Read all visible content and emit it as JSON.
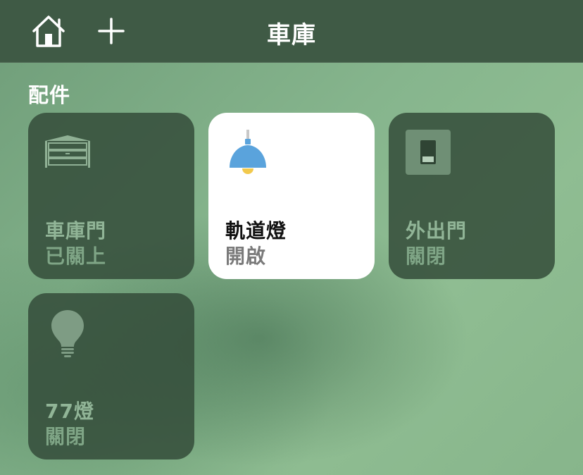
{
  "header": {
    "title": "車庫",
    "home_icon": "home-icon",
    "add_icon": "plus-icon"
  },
  "section": {
    "title": "配件"
  },
  "accessories": [
    {
      "name": "車庫門",
      "status": "已關上",
      "icon": "garage-door-icon",
      "on": false
    },
    {
      "name": "軌道燈",
      "status": "開啟",
      "icon": "pendant-lamp-icon",
      "on": true
    },
    {
      "name": "外出門",
      "status": "關閉",
      "icon": "switch-icon",
      "on": false
    },
    {
      "name": "77燈",
      "status": "關閉",
      "icon": "lightbulb-icon",
      "on": false
    }
  ],
  "colors": {
    "header_bg": "#3f5a45",
    "tile_off_bg": "#344d3a",
    "tile_on_bg": "#ffffff",
    "lamp_shade": "#5aa3dc",
    "lamp_bulb": "#f2c94c"
  }
}
